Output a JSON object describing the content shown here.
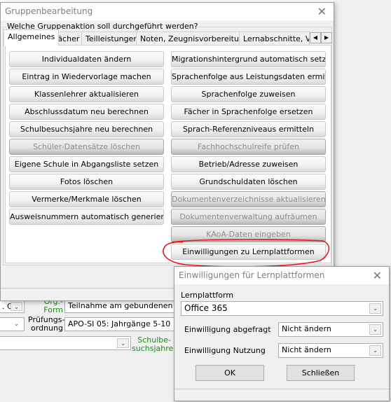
{
  "main_dialog": {
    "title": "Gruppenbearbeitung",
    "group_label": "Welche Gruppenaktion soll durchgeführt werden?",
    "tabs": [
      "Allgemeines",
      "Fächer",
      "Teilleistungen",
      "Noten, Zeugnisvorbereitung",
      "Lernabschnitte, Ver"
    ],
    "left_buttons": [
      {
        "label": "Individualdaten ändern",
        "enabled": true
      },
      {
        "label": "Eintrag in Wiedervorlage machen",
        "enabled": true
      },
      {
        "label": "Klassenlehrer aktualisieren",
        "enabled": true
      },
      {
        "label": "Abschlussdatum neu berechnen",
        "enabled": true
      },
      {
        "label": "Schulbesuchsjahre neu berechnen",
        "enabled": true
      },
      {
        "label": "Schüler-Datensätze löschen",
        "enabled": false
      },
      {
        "label": "Eigene Schule in Abgangsliste setzen",
        "enabled": true
      },
      {
        "label": "Fotos löschen",
        "enabled": true
      },
      {
        "label": "Vermerke/Merkmale löschen",
        "enabled": true
      },
      {
        "label": "Ausweisnummern automatisch generieren",
        "enabled": true
      }
    ],
    "right_buttons": [
      {
        "label": "Migrationshintergrund automatisch setzen",
        "enabled": true
      },
      {
        "label": "Sprachenfolge aus Leistungsdaten ermitteln",
        "enabled": true
      },
      {
        "label": "Sprachenfolge zuweisen",
        "enabled": true
      },
      {
        "label": "Fächer in Sprachenfolge ersetzen",
        "enabled": true
      },
      {
        "label": "Sprach-Referenzniveaus ermitteln",
        "enabled": true
      },
      {
        "label": "Fachhochschulreife prüfen",
        "enabled": false
      },
      {
        "label": "Betrieb/Adresse zuweisen",
        "enabled": true
      },
      {
        "label": "Grundschuldaten löschen",
        "enabled": true
      },
      {
        "label": "Dokumentenverzeichnisse aktualisieren",
        "enabled": false
      },
      {
        "label": "Dokumentenverwaltung aufräumen",
        "enabled": false
      },
      {
        "label": "KAoA-Daten eingeben",
        "enabled": false
      },
      {
        "label": "Einwilligungen zu Lernplattformen",
        "enabled": true
      }
    ],
    "highlight_color": "#e8141c"
  },
  "background": {
    "combo1": ". Q.",
    "orgform_label": "Org.-Form",
    "orgform_value": "Teilnahme am gebundenen Ganz",
    "pruefung_label": "Prüfungs-ordnung",
    "pruefung_value": "APO-SI 05: Jahrgänge 5-10",
    "schulbesuch_label": "Schulbe-suchsjahre"
  },
  "consent_dialog": {
    "title": "Einwilligungen für Lernplattformen",
    "platform_label": "Lernplattform",
    "platform_value": "Office 365",
    "asked_label": "Einwilligung abgefragt",
    "asked_value": "Nicht ändern",
    "usage_label": "Einwilligung Nutzung",
    "usage_value": "Nicht ändern",
    "ok_label": "OK",
    "close_label": "Schließen"
  }
}
